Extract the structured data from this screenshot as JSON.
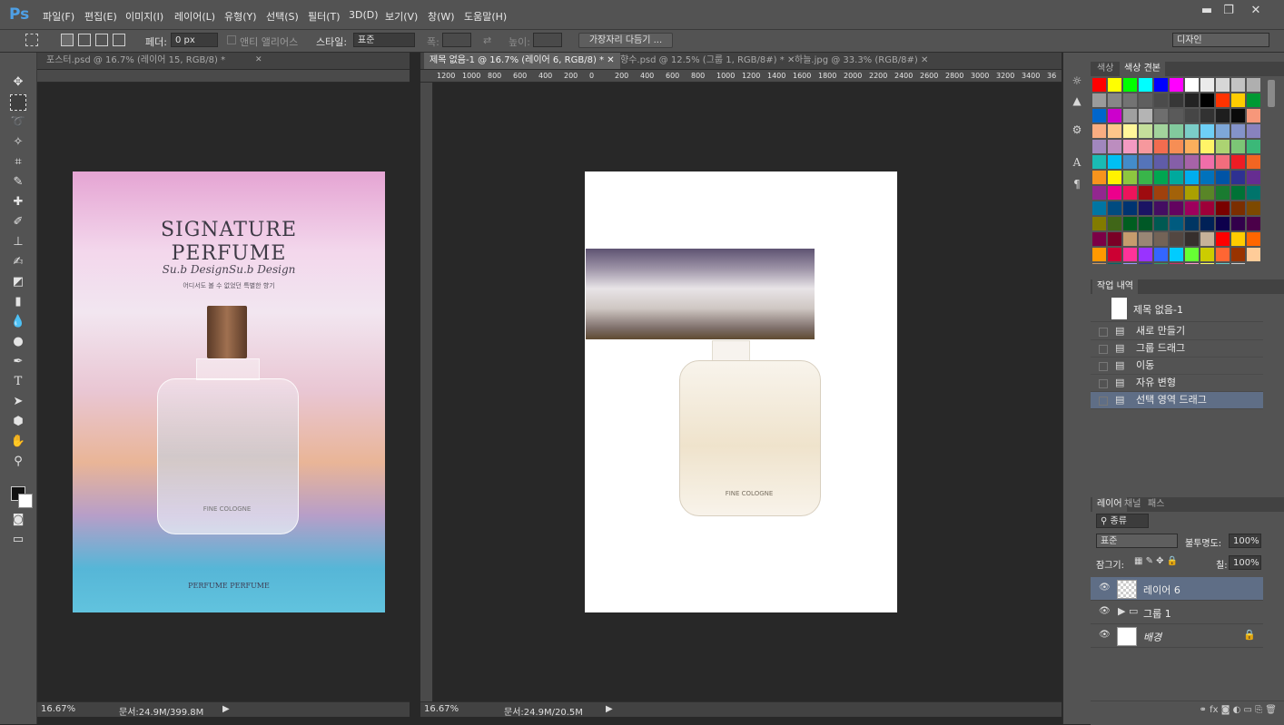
{
  "app": {
    "logo": "Ps"
  },
  "menu": [
    "파일(F)",
    "편집(E)",
    "이미지(I)",
    "레이어(L)",
    "유형(Y)",
    "선택(S)",
    "필터(T)",
    "3D(D)",
    "보기(V)",
    "창(W)",
    "도움말(H)"
  ],
  "window_controls": {
    "minimize": "▬",
    "restore": "❐",
    "close": "✕"
  },
  "options": {
    "feather_label": "페더:",
    "feather_value": "0 px",
    "antialias_label": "앤티 앨리어스",
    "style_label": "스타일:",
    "style_value": "표준",
    "width_label": "폭:",
    "height_label": "높이:",
    "refine_button": "가장자리 다듬기 ...",
    "workspace": "디자인"
  },
  "left_doc": {
    "tab": "포스터.psd @ 16.7% (레이어 15, RGB/8) *",
    "zoom": "16.67%",
    "doc_size": "문서:24.9M/399.8M",
    "poster": {
      "title_line1": "SIGNATURE",
      "title_line2": "PERFUME",
      "script": "Su.b DesignSu.b Design",
      "subtitle": "어디서도 볼 수 없었던 특별한 향기",
      "bottle_label": "FINE COLOGNE",
      "footer": "PERFUME PERFUME"
    }
  },
  "main_doc": {
    "tabs": [
      {
        "label": "제목 없음-1 @ 16.7% (레이어 6, RGB/8) *",
        "close": "✕",
        "active": true
      },
      {
        "label": "향수.psd @ 12.5% (그룹 1, RGB/8#) *",
        "close": "✕",
        "active": false
      },
      {
        "label": "하늘.jpg @ 33.3% (RGB/8#)",
        "close": "✕",
        "active": false
      }
    ],
    "ruler_labels": [
      "1200",
      "1000",
      "800",
      "600",
      "400",
      "200",
      "0",
      "200",
      "400",
      "600",
      "800",
      "1000",
      "1200",
      "1400",
      "1600",
      "1800",
      "2000",
      "2200",
      "2400",
      "2600",
      "2800",
      "3000",
      "3200",
      "3400",
      "36"
    ],
    "bottle_label": "FINE COLOGNE",
    "zoom": "16.67%",
    "doc_size": "문서:24.9M/20.5M"
  },
  "swatches_panel": {
    "tabs": [
      "색상",
      "색상 견본"
    ],
    "colors": [
      "#ff0000",
      "#ffff00",
      "#00ff00",
      "#00ffff",
      "#0000ff",
      "#ff00ff",
      "#ffffff",
      "#ebebeb",
      "#d7d7d7",
      "#c3c3c3",
      "#afafaf",
      "#9b9b9b",
      "#878787",
      "#737373",
      "#5f5f5f",
      "#4b4b4b",
      "#373737",
      "#232323",
      "#000000",
      "#ff3300",
      "#ffcc00",
      "#009933",
      "#0066cc",
      "#cc00cc",
      "#a0a0a0",
      "#b4b4b4",
      "#6e6e6e",
      "#5a5a5a",
      "#464646",
      "#323232",
      "#1e1e1e",
      "#0a0a0a",
      "#f7977a",
      "#f9ad81",
      "#fdc68a",
      "#fff79a",
      "#c4df9b",
      "#a2d39c",
      "#82ca9d",
      "#7bcdc8",
      "#6ecff6",
      "#7ea7d8",
      "#8493ca",
      "#8882be",
      "#a187be",
      "#bc8dbf",
      "#f49ac2",
      "#f6989d",
      "#f26c4f",
      "#f68e55",
      "#fbaf5c",
      "#fff467",
      "#acd372",
      "#7cc576",
      "#3bb878",
      "#1abbb4",
      "#00bff3",
      "#438cca",
      "#5574b9",
      "#605ca8",
      "#855fa8",
      "#a763a8",
      "#f06ea9",
      "#f26d7d",
      "#ed1c24",
      "#f26522",
      "#f7941d",
      "#fff200",
      "#8dc73f",
      "#39b54a",
      "#00a651",
      "#00a99d",
      "#00aeef",
      "#0072bc",
      "#0054a6",
      "#2e3192",
      "#662d91",
      "#92278f",
      "#ec008c",
      "#ed145b",
      "#9e0b0f",
      "#a0410d",
      "#a36209",
      "#aba000",
      "#598527",
      "#1a7b30",
      "#007236",
      "#00746b",
      "#0076a3",
      "#004b80",
      "#003471",
      "#1b1464",
      "#440e62",
      "#630460",
      "#9e005d",
      "#9e0039",
      "#790000",
      "#7b2e00",
      "#7d4900",
      "#827b00",
      "#406618",
      "#005e20",
      "#005826",
      "#005952",
      "#005b7f",
      "#003663",
      "#002157",
      "#0d004c",
      "#32004b",
      "#4b0049",
      "#7b0046",
      "#7a0026",
      "#c69c6d",
      "#998675",
      "#736357",
      "#534741",
      "#362f2d",
      "#c7b299",
      "#ff0000",
      "#ffcc00",
      "#ff6600",
      "#ff9900",
      "#cc0033",
      "#ff3399",
      "#9933ff",
      "#3366ff",
      "#00ccff",
      "#66ff33",
      "#cccc00",
      "#ff6633",
      "#993300",
      "#ffcc99",
      "#cc9966",
      "#006666",
      "#9999ff",
      "#333399",
      "#339966",
      "#cc3366",
      "#ff99cc",
      "#ffff66",
      "#66cccc",
      "#cccccc"
    ]
  },
  "history_panel": {
    "tab": "작업 내역",
    "snapshot": "제목 없음-1",
    "items": [
      "새로 만들기",
      "그룹 드래그",
      "이동",
      "자유 변형",
      "선택 영역 드래그"
    ],
    "selected_index": 4
  },
  "layers_panel": {
    "tabs": [
      "레이어",
      "채널",
      "패스"
    ],
    "filter": "종류",
    "blend_mode": "표준",
    "opacity_label": "불투명도:",
    "opacity": "100%",
    "lock_label": "잠그기:",
    "fill_label": "칠:",
    "fill": "100%",
    "layers": [
      {
        "name": "레이어 6",
        "type": "layer",
        "selected": true
      },
      {
        "name": "그룹 1",
        "type": "group",
        "selected": false
      },
      {
        "name": "배경",
        "type": "background",
        "selected": false
      }
    ]
  }
}
